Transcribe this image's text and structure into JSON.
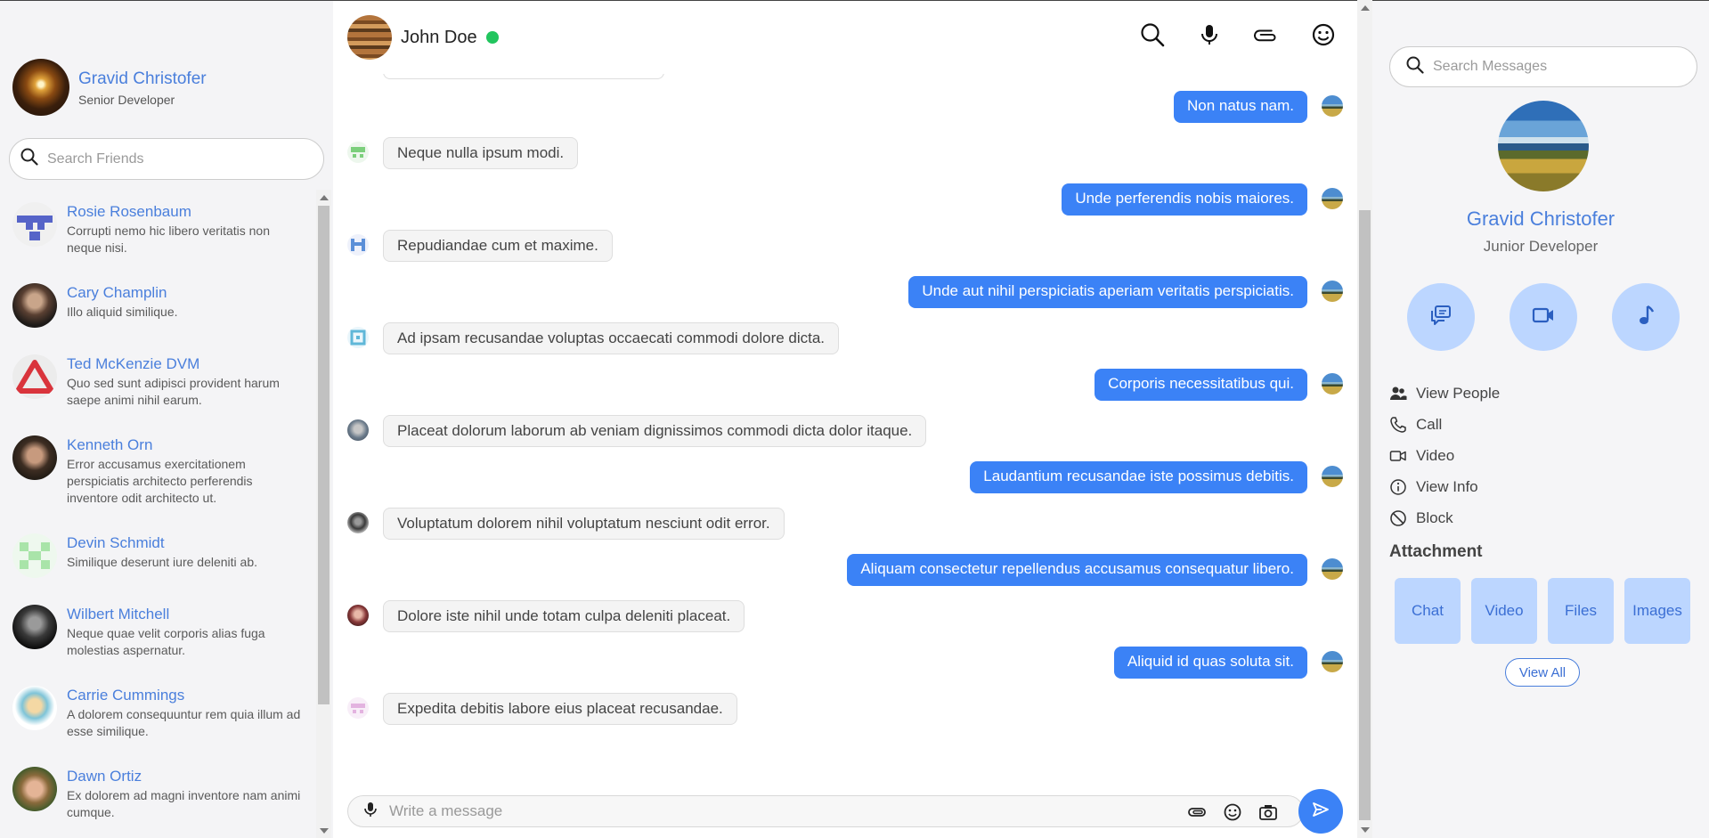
{
  "me": {
    "name": "Gravid Christofer",
    "role": "Senior Developer"
  },
  "friends_search": {
    "placeholder": "Search Friends"
  },
  "friends": [
    {
      "name": "Rosie Rosenbaum",
      "message": "Corrupti nemo hic libero veritatis non neque nisi.",
      "avatar": "identicon-blue"
    },
    {
      "name": "Cary Champlin",
      "message": "Illo aliquid similique.",
      "avatar": "photo-dark"
    },
    {
      "name": "Ted McKenzie DVM",
      "message": "Quo sed sunt adipisci provident harum saepe animi nihil earum.",
      "avatar": "red-triangle"
    },
    {
      "name": "Kenneth Orn",
      "message": "Error accusamus exercitationem perspiciatis architecto perferendis inventore odit architecto ut.",
      "avatar": "photo-man"
    },
    {
      "name": "Devin Schmidt",
      "message": "Similique deserunt iure deleniti ab.",
      "avatar": "identicon-green"
    },
    {
      "name": "Wilbert Mitchell",
      "message": "Neque quae velit corporis alias fuga molestias aspernatur.",
      "avatar": "photo-bw"
    },
    {
      "name": "Carrie Cummings",
      "message": "A dolorem consequuntur rem quia illum ad esse similique.",
      "avatar": "photo-cartoon"
    },
    {
      "name": "Dawn Ortiz",
      "message": "Ex dolorem ad magni inventore nam animi cumque.",
      "avatar": "photo-face"
    }
  ],
  "chat": {
    "contact_name": "John Doe",
    "status_color": "#22c55e",
    "header_icons": [
      "search-icon",
      "microphone-icon",
      "paperclip-icon",
      "smiley-icon"
    ],
    "messages": [
      {
        "dir": "out",
        "text": "Non natus nam."
      },
      {
        "dir": "in",
        "text": "Neque nulla ipsum modi."
      },
      {
        "dir": "out",
        "text": "Unde perferendis nobis maiores."
      },
      {
        "dir": "in",
        "text": "Repudiandae cum et maxime."
      },
      {
        "dir": "out",
        "text": "Unde aut nihil perspiciatis aperiam veritatis perspiciatis."
      },
      {
        "dir": "in",
        "text": "Ad ipsam recusandae voluptas occaecati commodi dolore dicta."
      },
      {
        "dir": "out",
        "text": "Corporis necessitatibus qui."
      },
      {
        "dir": "in",
        "text": "Placeat dolorum laborum ab veniam dignissimos commodi dicta dolor itaque."
      },
      {
        "dir": "out",
        "text": "Laudantium recusandae iste possimus debitis."
      },
      {
        "dir": "in",
        "text": "Voluptatum dolorem nihil voluptatum nesciunt odit error."
      },
      {
        "dir": "out",
        "text": "Aliquam consectetur repellendus accusamus consequatur libero."
      },
      {
        "dir": "in",
        "text": "Dolore iste nihil unde totam culpa deleniti placeat."
      },
      {
        "dir": "out",
        "text": "Aliquid id quas soluta sit."
      },
      {
        "dir": "in",
        "text": "Expedita debitis labore eius placeat recusandae."
      }
    ],
    "composer_placeholder": "Write a message"
  },
  "profile": {
    "search_placeholder": "Search Messages",
    "name": "Gravid Christofer",
    "role": "Junior Developer",
    "actions": [
      {
        "label": "View People",
        "icon": "people-icon"
      },
      {
        "label": "Call",
        "icon": "phone-icon"
      },
      {
        "label": "Video",
        "icon": "video-icon"
      },
      {
        "label": "View Info",
        "icon": "info-icon"
      },
      {
        "label": "Block",
        "icon": "block-icon"
      }
    ],
    "attachment_title": "Attachment",
    "attachments": [
      "Chat",
      "Video",
      "Files",
      "Images"
    ],
    "view_all": "View All"
  },
  "colors": {
    "accent": "#3b82f6",
    "link": "#4a7fdc",
    "light_accent": "#bcd6ff"
  }
}
